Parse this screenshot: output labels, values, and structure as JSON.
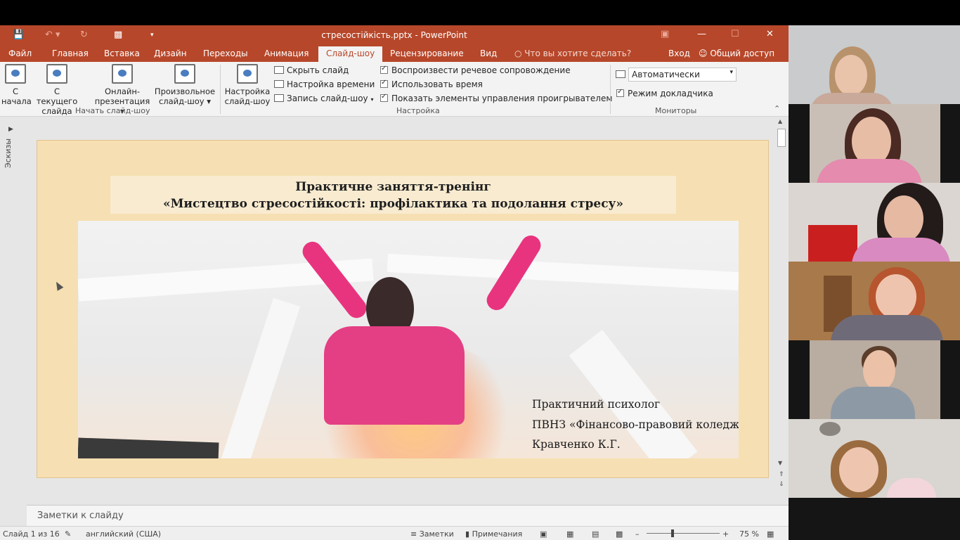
{
  "window": {
    "title": "стресостійкість.pptx - PowerPoint"
  },
  "tabs": [
    {
      "label": "Файл"
    },
    {
      "label": "Главная"
    },
    {
      "label": "Вставка"
    },
    {
      "label": "Дизайн"
    },
    {
      "label": "Переходы"
    },
    {
      "label": "Анимация"
    },
    {
      "label": "Слайд-шоу",
      "active": true
    },
    {
      "label": "Рецензирование"
    },
    {
      "label": "Вид"
    }
  ],
  "tell_me": "Что вы хотите сделать?",
  "account": {
    "sign_in": "Вход",
    "share": "Общий доступ"
  },
  "ribbon": {
    "start_group": {
      "label": "Начать слайд-шоу",
      "buttons": [
        {
          "line1": "С",
          "line2": "начала"
        },
        {
          "line1": "С текущего",
          "line2": "слайда"
        },
        {
          "line1": "Онлайн-",
          "line2": "презентация ▾"
        },
        {
          "line1": "Произвольное",
          "line2": "слайд-шоу ▾"
        }
      ]
    },
    "setup_group": {
      "label": "Настройка",
      "setup_button": {
        "line1": "Настройка",
        "line2": "слайд-шоу"
      },
      "hide_slide": "Скрыть слайд",
      "rehearse_timings": "Настройка времени",
      "record": "Запись слайд-шоу",
      "play_narrations": "Воспроизвести речевое сопровождение",
      "use_timings": "Использовать время",
      "show_media_controls": "Показать элементы управления проигрывателем"
    },
    "monitors_group": {
      "label": "Мониторы",
      "monitor_value": "Автоматически",
      "presenter_view": "Режим докладчика"
    }
  },
  "thumbnails_label": "Эскизы",
  "slide": {
    "title_line1": "Практичне заняття-тренінг",
    "title_line2": "«Мистецтво стресостійкості: профілактика та подолання стресу»",
    "author_line1": "Практичний психолог",
    "author_line2": "ПВНЗ «Фінансово-правовий коледж»",
    "author_line3": "Кравченко К.Г."
  },
  "notes_placeholder": "Заметки к слайду",
  "status": {
    "slide_counter": "Слайд 1 из 16",
    "language": "английский (США)",
    "notes_btn": "Заметки",
    "comments_btn": "Примечания",
    "zoom": "75 %"
  },
  "colors": {
    "accent": "#b7472a",
    "slide_bg": "#f6dfb2"
  }
}
